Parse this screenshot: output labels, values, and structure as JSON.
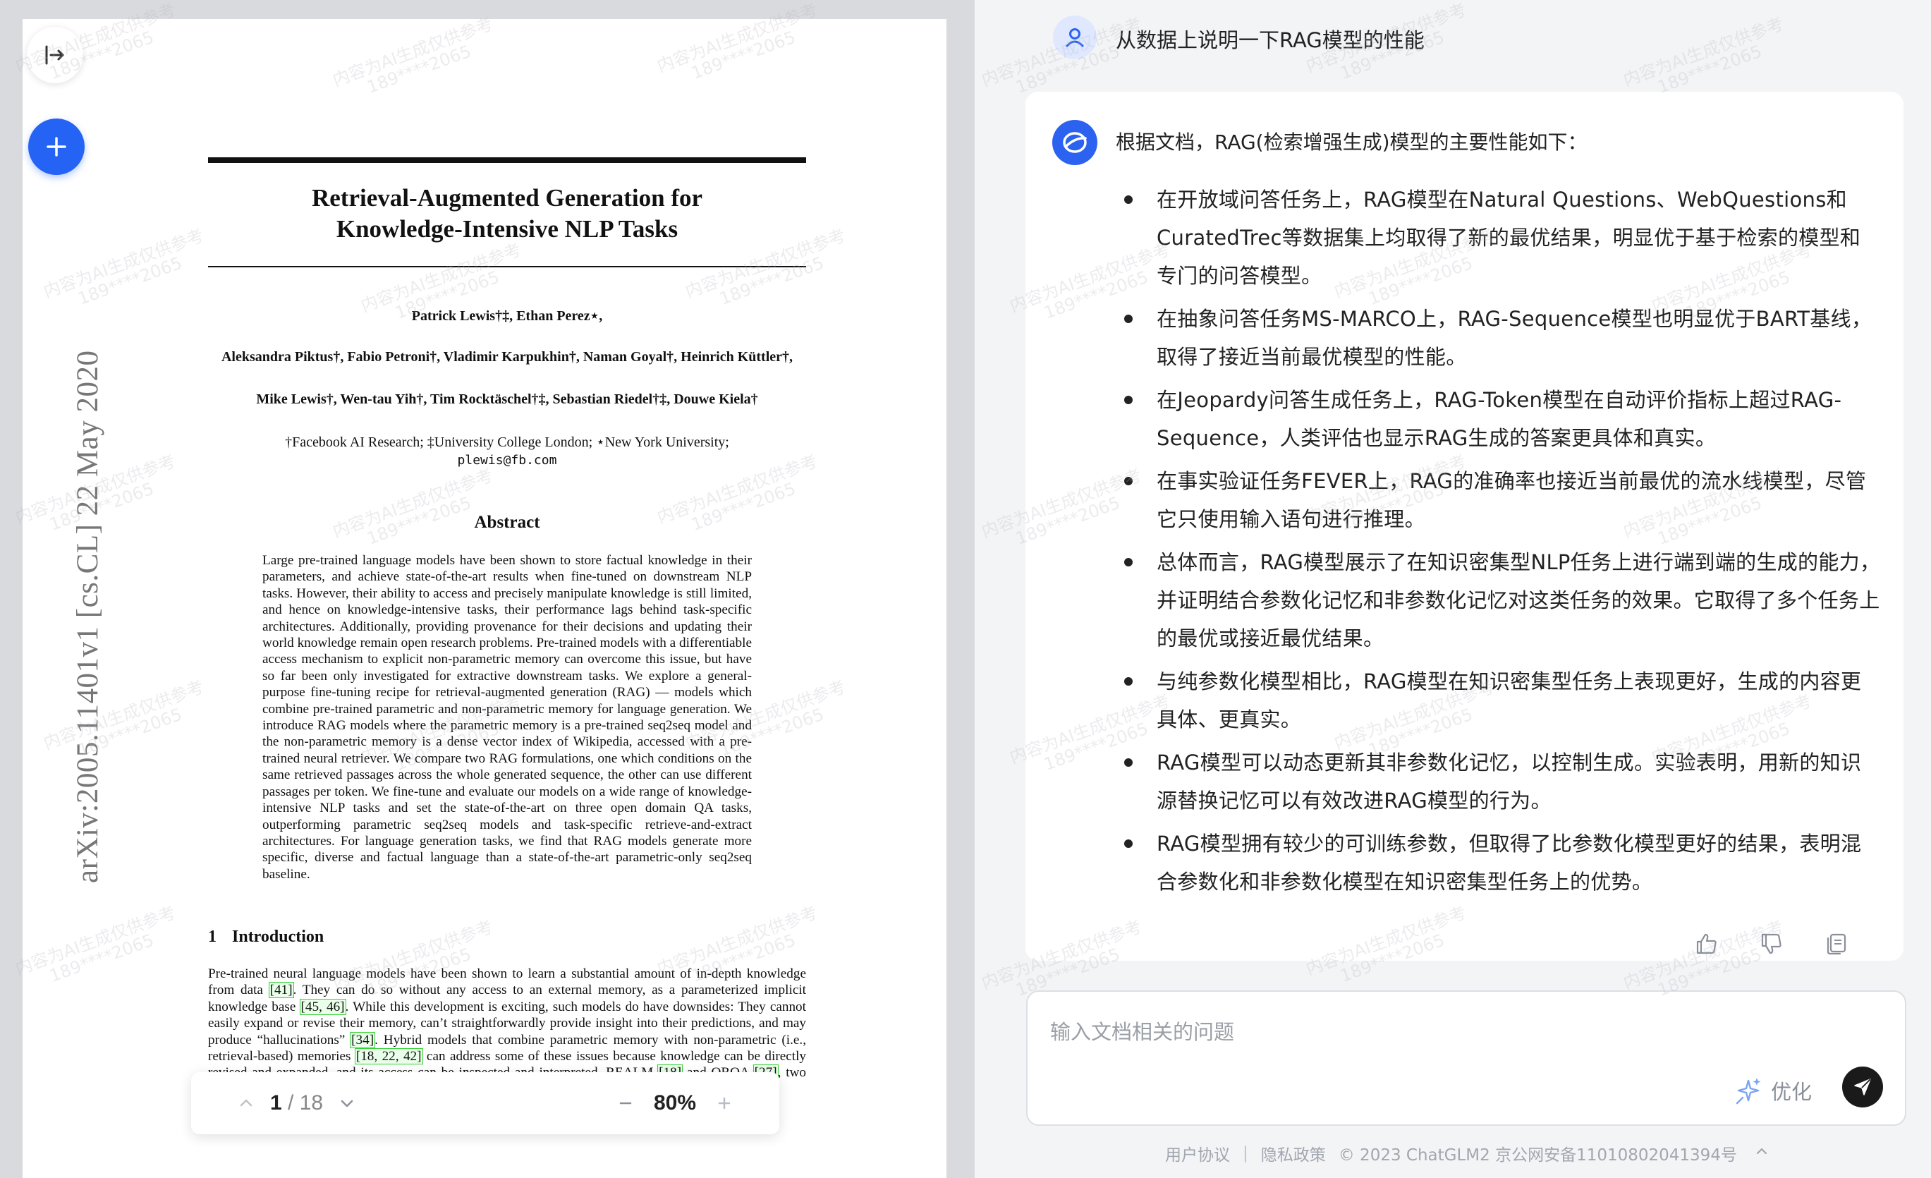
{
  "pdf": {
    "arxiv_id": "arXiv:2005.11401v1  [cs.CL]  22 May 2020",
    "title_line1": "Retrieval-Augmented Generation for",
    "title_line2": "Knowledge-Intensive NLP Tasks",
    "authors_line1": "Patrick Lewis†‡, Ethan Perez⋆,",
    "authors_line2": "Aleksandra Piktus†, Fabio Petroni†, Vladimir Karpukhin†, Naman Goyal†, Heinrich Küttler†,",
    "authors_line3": "Mike Lewis†, Wen-tau Yih†, Tim Rocktäschel†‡, Sebastian Riedel†‡, Douwe Kiela†",
    "affiliations": "†Facebook AI Research; ‡University College London; ⋆New York University;",
    "email": "plewis@fb.com",
    "abstract_heading": "Abstract",
    "abstract_text": "Large pre-trained language models have been shown to store factual knowledge in their parameters, and achieve state-of-the-art results when fine-tuned on downstream NLP tasks. However, their ability to access and precisely manipulate knowledge is still limited, and hence on knowledge-intensive tasks, their performance lags behind task-specific architectures. Additionally, providing provenance for their decisions and updating their world knowledge remain open research problems. Pre-trained models with a differentiable access mechanism to explicit non-parametric memory can overcome this issue, but have so far been only investigated for extractive downstream tasks. We explore a general-purpose fine-tuning recipe for retrieval-augmented generation (RAG) — models which combine pre-trained parametric and non-parametric memory for language generation. We introduce RAG models where the parametric memory is a pre-trained seq2seq model and the non-parametric memory is a dense vector index of Wikipedia, accessed with a pre-trained neural retriever. We compare two RAG formulations, one which conditions on the same retrieved passages across the whole generated sequence, the other can use different passages per token. We fine-tune and evaluate our models on a wide range of knowledge-intensive NLP tasks and set the state-of-the-art on three open domain QA tasks, outperforming parametric seq2seq models and task-specific retrieve-and-extract architectures. For language generation tasks, we find that RAG models generate more specific, diverse and factual language than a state-of-the-art parametric-only seq2seq baseline.",
    "intro_number": "1",
    "intro_heading": "Introduction",
    "intro_p1": "Pre-trained neural language models have been shown to learn a substantial amount of in-depth knowledge from data ",
    "cite1": "[41]",
    "intro_p2": ". They can do so without any access to an external memory, as a parameterized implicit knowledge base ",
    "cite2": "[45, 46]",
    "intro_p3": ". While this development is exciting, such models do have downsides: They cannot easily expand or revise their memory, can’t straightforwardly provide insight into their predictions, and may produce “hallucinations” ",
    "cite3": "[34]",
    "intro_p4": ". Hybrid models that combine parametric memory with non-parametric (i.e., retrieval-based) memories ",
    "cite4": "[18, 22, 42]",
    "intro_p5": " can address some of these issues because knowledge can be directly revised and expanded, and its access can be inspected and interpreted. REALM ",
    "cite5": "[18]",
    "intro_p6": " and ORQA ",
    "cite6": "[27]",
    "intro_p7": ", two recently introduced models that c",
    "toolbar": {
      "current_page": "1",
      "total_pages": "/ 18",
      "zoom": "80%"
    }
  },
  "watermark": {
    "line1": "内容为AI生成仅供参考",
    "line2": "189****2065"
  },
  "chat": {
    "user_question": "从数据上说明一下RAG模型的性能",
    "answer_intro": "根据文档，RAG(检索增强生成)模型的主要性能如下：",
    "answer_points": [
      "在开放域问答任务上，RAG模型在Natural Questions、WebQuestions和CuratedTrec等数据集上均取得了新的最优结果，明显优于基于检索的模型和专门的问答模型。",
      "在抽象问答任务MS-MARCO上，RAG-Sequence模型也明显优于BART基线，取得了接近当前最优模型的性能。",
      "在Jeopardy问答生成任务上，RAG-Token模型在自动评价指标上超过RAG-Sequence，人类评估也显示RAG生成的答案更具体和真实。",
      "在事实验证任务FEVER上，RAG的准确率也接近当前最优的流水线模型，尽管它只使用输入语句进行推理。",
      "总体而言，RAG模型展示了在知识密集型NLP任务上进行端到端的生成的能力，并证明结合参数化记忆和非参数化记忆对这类任务的效果。它取得了多个任务上的最优或接近最优结果。",
      "与纯参数化模型相比，RAG模型在知识密集型任务上表现更好，生成的内容更具体、更真实。",
      "RAG模型可以动态更新其非参数化记忆，以控制生成。实验表明，用新的知识源替换记忆可以有效改进RAG模型的行为。",
      "RAG模型拥有较少的可训练参数，但取得了比参数化模型更好的结果，表明混合参数化和非参数化模型在知识密集型任务上的优势。"
    ],
    "input_placeholder": "输入文档相关的问题",
    "optimize_label": "优化"
  },
  "footer": {
    "user_agreement": "用户协议",
    "privacy_policy": "隐私政策",
    "copyright": "© 2023 ChatGLM2 京公网安备11010802041394号"
  },
  "colors": {
    "accent_blue": "#2563f5",
    "send_button": "#1a1a1a",
    "citation_box": "#35d035"
  }
}
